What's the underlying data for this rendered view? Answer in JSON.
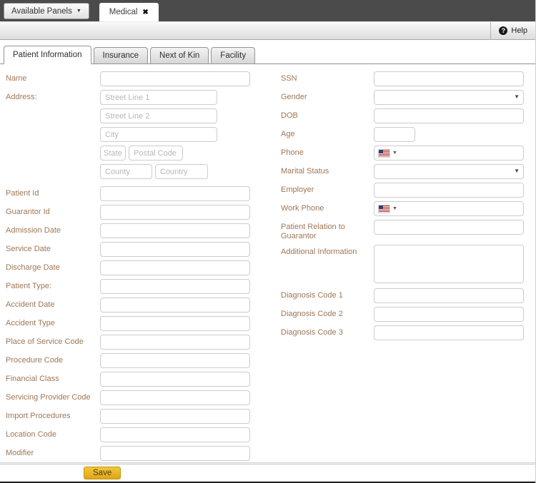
{
  "window": {
    "available_panels_button": "Available Panels",
    "available_panels_caret": "▼",
    "panel_tab_label": "Medical",
    "panel_tab_close_icon": "✖",
    "help_button_label": "Help",
    "help_icon_glyph": "?"
  },
  "tabs": [
    {
      "label": "Patient Information",
      "active": true
    },
    {
      "label": "Insurance",
      "active": false
    },
    {
      "label": "Next of Kin",
      "active": false
    },
    {
      "label": "Facility",
      "active": false
    }
  ],
  "form": {
    "left": {
      "name_label": "Name",
      "name_value": "",
      "address_label": "Address:",
      "address_placeholders": {
        "street1": "Street Line 1",
        "street2": "Street Line 2",
        "city": "City",
        "state": "State",
        "postal_code": "Postal Code",
        "county": "County",
        "country": "Country"
      },
      "rows": [
        {
          "label": "Patient Id",
          "value": ""
        },
        {
          "label": "Guarantor Id",
          "value": ""
        },
        {
          "label": "Admission Date",
          "value": ""
        },
        {
          "label": "Service Date",
          "value": ""
        },
        {
          "label": "Discharge Date",
          "value": ""
        },
        {
          "label": "Patient Type:",
          "value": ""
        },
        {
          "label": "Accident Date",
          "value": ""
        },
        {
          "label": "Accident Type",
          "value": ""
        },
        {
          "label": "Place of Service Code",
          "value": ""
        },
        {
          "label": "Procedure Code",
          "value": ""
        },
        {
          "label": "Financial Class",
          "value": ""
        },
        {
          "label": "Servicing Provider Code",
          "value": ""
        },
        {
          "label": "Import Procedures",
          "value": ""
        },
        {
          "label": "Location Code",
          "value": ""
        },
        {
          "label": "Modifier",
          "value": ""
        }
      ]
    },
    "right": {
      "ssn_label": "SSN",
      "gender_label": "Gender",
      "gender_selected": "",
      "dob_label": "DOB",
      "age_label": "Age",
      "phone_label": "Phone",
      "marital_status_label": "Marital Status",
      "marital_status_selected": "",
      "employer_label": "Employer",
      "work_phone_label": "Work Phone",
      "patient_relation_label": "Patient Relation to Guarantor",
      "additional_info_label": "Additional Information",
      "additional_info_value": "",
      "diagnosis_code_1_label": "Diagnosis Code 1",
      "diagnosis_code_2_label": "Diagnosis Code 2",
      "diagnosis_code_3_label": "Diagnosis Code 3"
    },
    "save_button_label": "Save"
  },
  "colors": {
    "topbar_bg": "#4b4b4b",
    "label_text": "#9e7757",
    "save_button_bg": "#e9b522",
    "save_button_border": "#c3950f",
    "tab_border": "#949494"
  }
}
